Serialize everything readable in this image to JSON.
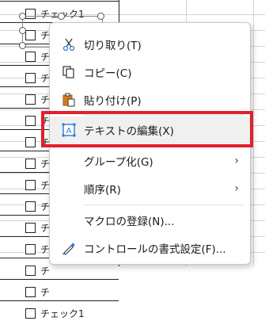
{
  "checkboxes": [
    {
      "label": "チェック1"
    },
    {
      "label": "チ"
    },
    {
      "label": "チ"
    },
    {
      "label": "チ"
    },
    {
      "label": "チ"
    },
    {
      "label": "チ"
    },
    {
      "label": "チ"
    },
    {
      "label": "チ"
    },
    {
      "label": "チ"
    },
    {
      "label": "チ"
    },
    {
      "label": "チ"
    },
    {
      "label": "チ"
    },
    {
      "label": "チ"
    },
    {
      "label": "チ"
    },
    {
      "label": "チェック1"
    }
  ],
  "menu": {
    "items": [
      {
        "label": "切り取り(T)",
        "icon": "scissors-icon"
      },
      {
        "label": "コピー(C)",
        "icon": "copy-icon"
      },
      {
        "label": "貼り付け(P)",
        "icon": "paste-icon"
      },
      {
        "label": "テキストの編集(X)",
        "icon": "edit-text-icon"
      },
      {
        "label": "グループ化(G)",
        "icon": "",
        "arrow": "›"
      },
      {
        "label": "順序(R)",
        "icon": "",
        "arrow": "›"
      },
      {
        "label": "マクロの登録(N)...",
        "icon": ""
      },
      {
        "label": "コントロールの書式設定(F)...",
        "icon": "format-control-icon"
      }
    ]
  },
  "colors": {
    "highlight": "#e0202d",
    "accent": "#2b7cd3",
    "paste": "#d97a1c"
  }
}
